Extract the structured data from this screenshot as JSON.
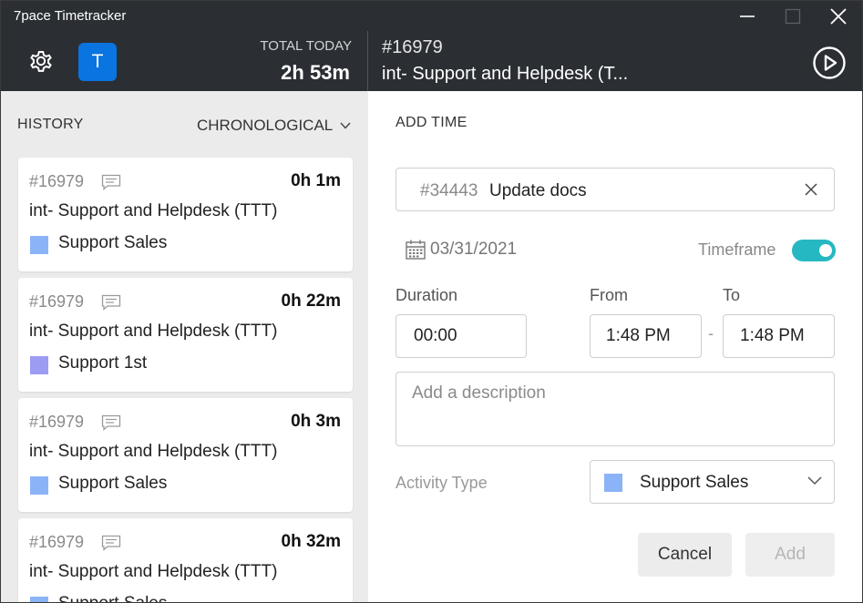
{
  "window": {
    "title": "7pace Timetracker"
  },
  "header": {
    "avatar_initial": "T",
    "total_label": "TOTAL TODAY",
    "total_value": "2h 53m",
    "task_id": "#16979",
    "task_title": "int- Support and Helpdesk (T..."
  },
  "history": {
    "label": "HISTORY",
    "sort_label": "CHRONOLOGICAL",
    "items": [
      {
        "id": "#16979",
        "duration": "0h 1m",
        "title": "int- Support and Helpdesk (TTT)",
        "activity": "Support Sales",
        "color": "#8bb3f7"
      },
      {
        "id": "#16979",
        "duration": "0h 22m",
        "title": "int- Support and Helpdesk (TTT)",
        "activity": "Support 1st",
        "color": "#9b9cf2"
      },
      {
        "id": "#16979",
        "duration": "0h 3m",
        "title": "int- Support and Helpdesk (TTT)",
        "activity": "Support Sales",
        "color": "#8bb3f7"
      },
      {
        "id": "#16979",
        "duration": "0h 32m",
        "title": "int- Support and Helpdesk (TTT)",
        "activity": "Support Sales",
        "color": "#8bb3f7"
      }
    ]
  },
  "add_time": {
    "label": "ADD TIME",
    "task_id": "#34443",
    "task_name": "Update docs",
    "date": "03/31/2021",
    "timeframe_label": "Timeframe",
    "timeframe_on": true,
    "duration_label": "Duration",
    "duration_value": "00:00",
    "from_label": "From",
    "from_value": "1:48 PM",
    "to_label": "To",
    "to_value": "1:48 PM",
    "description_placeholder": "Add a description",
    "activity_label": "Activity Type",
    "activity_value": "Support Sales",
    "activity_color": "#8bb3f7",
    "cancel_label": "Cancel",
    "add_label": "Add"
  },
  "colors": {
    "header_bg": "#2b2f34",
    "accent_blue": "#0a74e0",
    "toggle_teal": "#26b8c2"
  }
}
